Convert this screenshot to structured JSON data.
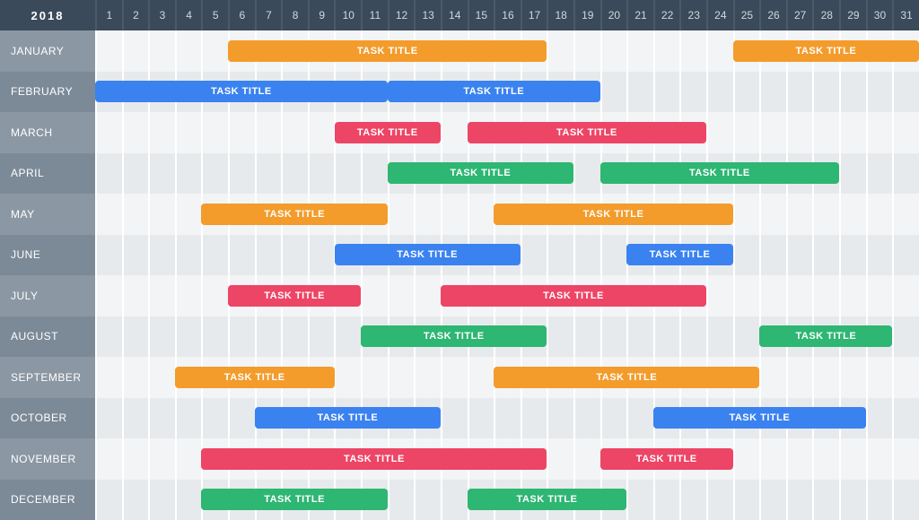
{
  "chart_data": {
    "type": "gantt",
    "year": "2018",
    "days": 31,
    "colors": {
      "orange": "#f39c2c",
      "blue": "#3a82f0",
      "pink": "#ed4566",
      "green": "#2eb673"
    },
    "months": [
      {
        "name": "JANUARY",
        "tasks": [
          {
            "label": "TASK TITLE",
            "start": 6,
            "end": 17,
            "color": "orange"
          },
          {
            "label": "TASK TITLE",
            "start": 25,
            "end": 31,
            "color": "orange"
          }
        ]
      },
      {
        "name": "FEBRUARY",
        "tasks": [
          {
            "label": "TASK TITLE",
            "start": 1,
            "end": 11,
            "color": "blue"
          },
          {
            "label": "TASK TITLE",
            "start": 12,
            "end": 19,
            "color": "blue"
          }
        ]
      },
      {
        "name": "MARCH",
        "tasks": [
          {
            "label": "TASK TITLE",
            "start": 10,
            "end": 13,
            "color": "pink"
          },
          {
            "label": "TASK TITLE",
            "start": 15,
            "end": 23,
            "color": "pink"
          }
        ]
      },
      {
        "name": "APRIL",
        "tasks": [
          {
            "label": "TASK TITLE",
            "start": 12,
            "end": 18,
            "color": "green"
          },
          {
            "label": "TASK TITLE",
            "start": 20,
            "end": 28,
            "color": "green"
          }
        ]
      },
      {
        "name": "MAY",
        "tasks": [
          {
            "label": "TASK TITLE",
            "start": 5,
            "end": 11,
            "color": "orange"
          },
          {
            "label": "TASK TITLE",
            "start": 16,
            "end": 24,
            "color": "orange"
          }
        ]
      },
      {
        "name": "JUNE",
        "tasks": [
          {
            "label": "TASK TITLE",
            "start": 10,
            "end": 16,
            "color": "blue"
          },
          {
            "label": "TASK TITLE",
            "start": 21,
            "end": 24,
            "color": "blue"
          }
        ]
      },
      {
        "name": "JULY",
        "tasks": [
          {
            "label": "TASK TITLE",
            "start": 6,
            "end": 10,
            "color": "pink"
          },
          {
            "label": "TASK TITLE",
            "start": 14,
            "end": 23,
            "color": "pink"
          }
        ]
      },
      {
        "name": "AUGUST",
        "tasks": [
          {
            "label": "TASK TITLE",
            "start": 11,
            "end": 17,
            "color": "green"
          },
          {
            "label": "TASK TITLE",
            "start": 26,
            "end": 30,
            "color": "green"
          }
        ]
      },
      {
        "name": "SEPTEMBER",
        "tasks": [
          {
            "label": "TASK TITLE",
            "start": 4,
            "end": 9,
            "color": "orange"
          },
          {
            "label": "TASK TITLE",
            "start": 16,
            "end": 25,
            "color": "orange"
          }
        ]
      },
      {
        "name": "OCTOBER",
        "tasks": [
          {
            "label": "TASK TITLE",
            "start": 7,
            "end": 13,
            "color": "blue"
          },
          {
            "label": "TASK TITLE",
            "start": 22,
            "end": 29,
            "color": "blue"
          }
        ]
      },
      {
        "name": "NOVEMBER",
        "tasks": [
          {
            "label": "TASK TITLE",
            "start": 5,
            "end": 17,
            "color": "pink"
          },
          {
            "label": "TASK TITLE",
            "start": 20,
            "end": 24,
            "color": "pink"
          }
        ]
      },
      {
        "name": "DECEMBER",
        "tasks": [
          {
            "label": "TASK TITLE",
            "start": 5,
            "end": 11,
            "color": "green"
          },
          {
            "label": "TASK TITLE",
            "start": 15,
            "end": 20,
            "color": "green"
          }
        ]
      }
    ]
  }
}
